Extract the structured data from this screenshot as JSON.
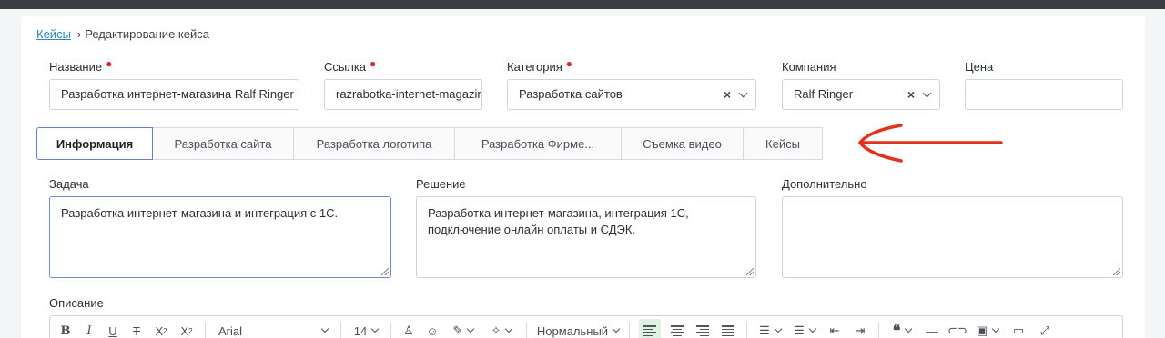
{
  "breadcrumb": {
    "link": "Кейсы",
    "separator": "›",
    "current": "Редактирование кейса"
  },
  "fields": {
    "name": {
      "label": "Название",
      "value": "Разработка интернет-магазина Ralf Ringer"
    },
    "link": {
      "label": "Ссылка",
      "value": "razrabotka-internet-magazina"
    },
    "category": {
      "label": "Категория",
      "value": "Разработка сайтов"
    },
    "company": {
      "label": "Компания",
      "value": "Ralf Ringer"
    },
    "price": {
      "label": "Цена",
      "value": ""
    }
  },
  "tabs": [
    {
      "label": "Информация",
      "active": true
    },
    {
      "label": "Разработка сайта"
    },
    {
      "label": "Разработка логотипа"
    },
    {
      "label": "Разработка Фирме..."
    },
    {
      "label": "Съемка видео"
    },
    {
      "label": "Кейсы"
    }
  ],
  "task": {
    "label": "Задача",
    "value": "Разработка интернет-магазина и интеграция с 1С."
  },
  "solution": {
    "label": "Решение",
    "line1": "Разработка интернет-магазина, интеграция 1С,",
    "line2": "подключение онлайн оплаты и СДЭК."
  },
  "extra": {
    "label": "Дополнительно",
    "value": ""
  },
  "description": {
    "label": "Описание"
  },
  "toolbar": {
    "font": "Arial",
    "size": "14",
    "style": "Нормальный"
  },
  "colors": {
    "accent_tab": "#6a7fc8",
    "required": "#e0262b",
    "arrow": "#e2321e",
    "link": "#2f86c5"
  }
}
